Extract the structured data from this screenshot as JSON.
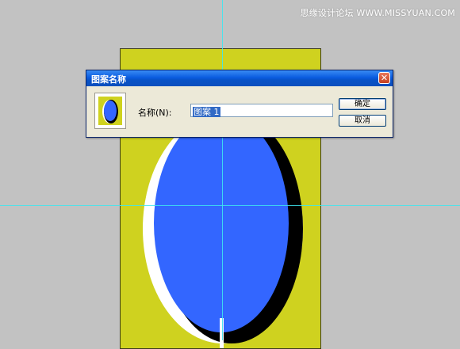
{
  "watermark": "思缘设计论坛 WWW.MISSYUAN.COM",
  "dialog": {
    "title": "图案名称",
    "close_glyph": "✕",
    "name_label": "名称(N):",
    "name_value": "图案 1",
    "ok_label": "确定",
    "cancel_label": "取消"
  },
  "colors": {
    "canvas_background": "#c2c2c2",
    "document_fill": "#cfd21f",
    "ellipse_fill": "#3366ff",
    "guide": "#3ee6f0",
    "titlebar": "#0a5ce0"
  }
}
